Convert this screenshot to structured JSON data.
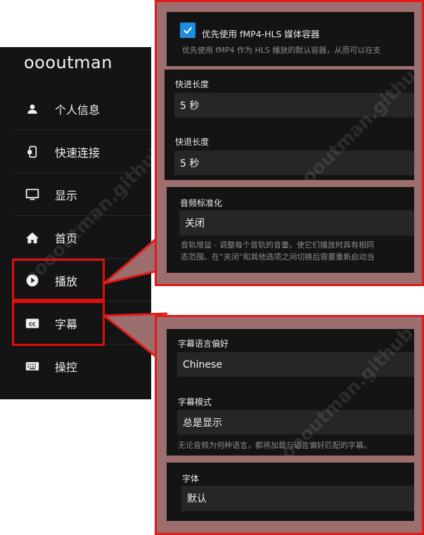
{
  "sidebar": {
    "title": "oooutman",
    "items": [
      {
        "label": "个人信息",
        "icon": "person-icon"
      },
      {
        "label": "快速连接",
        "icon": "phone-connect-icon"
      },
      {
        "label": "显示",
        "icon": "monitor-icon"
      },
      {
        "label": "首页",
        "icon": "home-icon"
      },
      {
        "label": "播放",
        "icon": "play-circle-icon"
      },
      {
        "label": "字幕",
        "icon": "closed-caption-icon"
      },
      {
        "label": "操控",
        "icon": "keyboard-icon"
      }
    ]
  },
  "playback": {
    "fmp4_label": "优先使用 fMP4-HLS 媒体容器",
    "fmp4_checked": true,
    "fmp4_desc": "优先使用 fMP4 作为 HLS 播放的默认容器，从而可以在支",
    "ff_label": "快进长度",
    "ff_value": "5 秒",
    "rew_label": "快退长度",
    "rew_value": "5 秒",
    "norm_label": "音频标准化",
    "norm_value": "关闭",
    "norm_desc1": "音轨增益 - 调整每个音轨的音量，使它们播放时具有相同",
    "norm_desc2": "态范围。在“关闭”和其他选项之间切换后需要重新启动当"
  },
  "subtitles": {
    "lang_label": "字幕语言偏好",
    "lang_value": "Chinese",
    "mode_label": "字幕模式",
    "mode_value": "总是显示",
    "mode_desc": "无论音频为何种语言，都将加载与语言偏好匹配的字幕。",
    "font_label": "字体",
    "font_value": "默认"
  },
  "watermark": "ooooutman.github.io",
  "colors": {
    "highlight": "#e00d0d",
    "checkbox": "#1d8ede",
    "panel": "#141414",
    "field": "#262626"
  }
}
